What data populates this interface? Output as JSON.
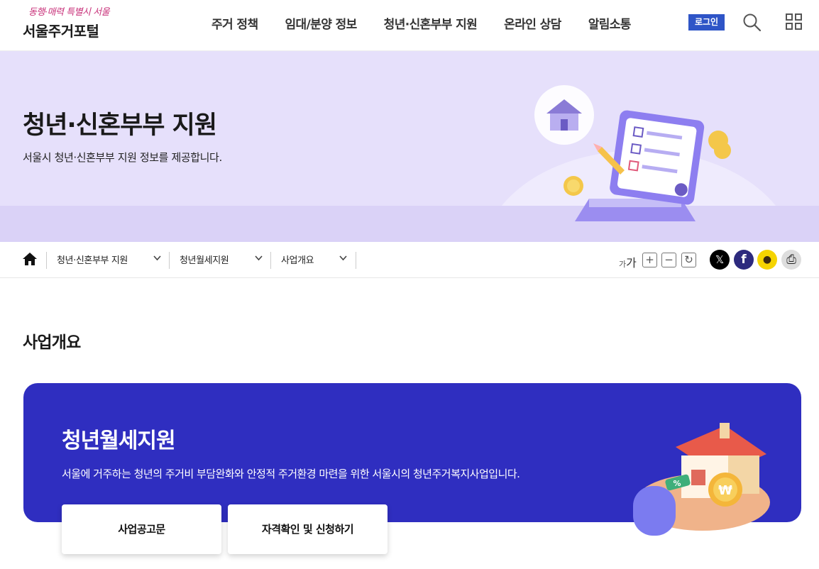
{
  "header": {
    "slogan": "동행·매력 특별시 서울",
    "logo": "서울주거포털",
    "nav": [
      "주거 정책",
      "임대/분양 정보",
      "청년·신혼부부 지원",
      "온라인 상담",
      "알림소통"
    ],
    "login_label": "로그인"
  },
  "hero": {
    "title": "청년·신혼부부 지원",
    "description": "서울시 청년·신혼부부 지원 정보를 제공합니다."
  },
  "breadcrumb": {
    "items": [
      "청년·신혼부부 지원",
      "청년월세지원",
      "사업개요"
    ]
  },
  "font_size_control": {
    "label_small": "가",
    "label_large": "가",
    "plus": "+",
    "minus": "−",
    "reset": "↻"
  },
  "share": {
    "x_label": "𝕏",
    "facebook_label": "f",
    "kakao_label": "●",
    "print_label": "⎙"
  },
  "section": {
    "title": "사업개요"
  },
  "card": {
    "title": "청년월세지원",
    "description": "서울에 거주하는 청년의 주거비 부담완화와 안정적 주거환경 마련을 위한 서울시의 청년주거복지사업입니다.",
    "buttons": [
      "사업공고문",
      "자격확인 및 신청하기"
    ],
    "badge_percent": "%",
    "coin_symbol": "₩"
  },
  "colors": {
    "primary": "#2f2ec0",
    "login": "#2f55c7",
    "hero_bg": "#e6e0fb"
  }
}
